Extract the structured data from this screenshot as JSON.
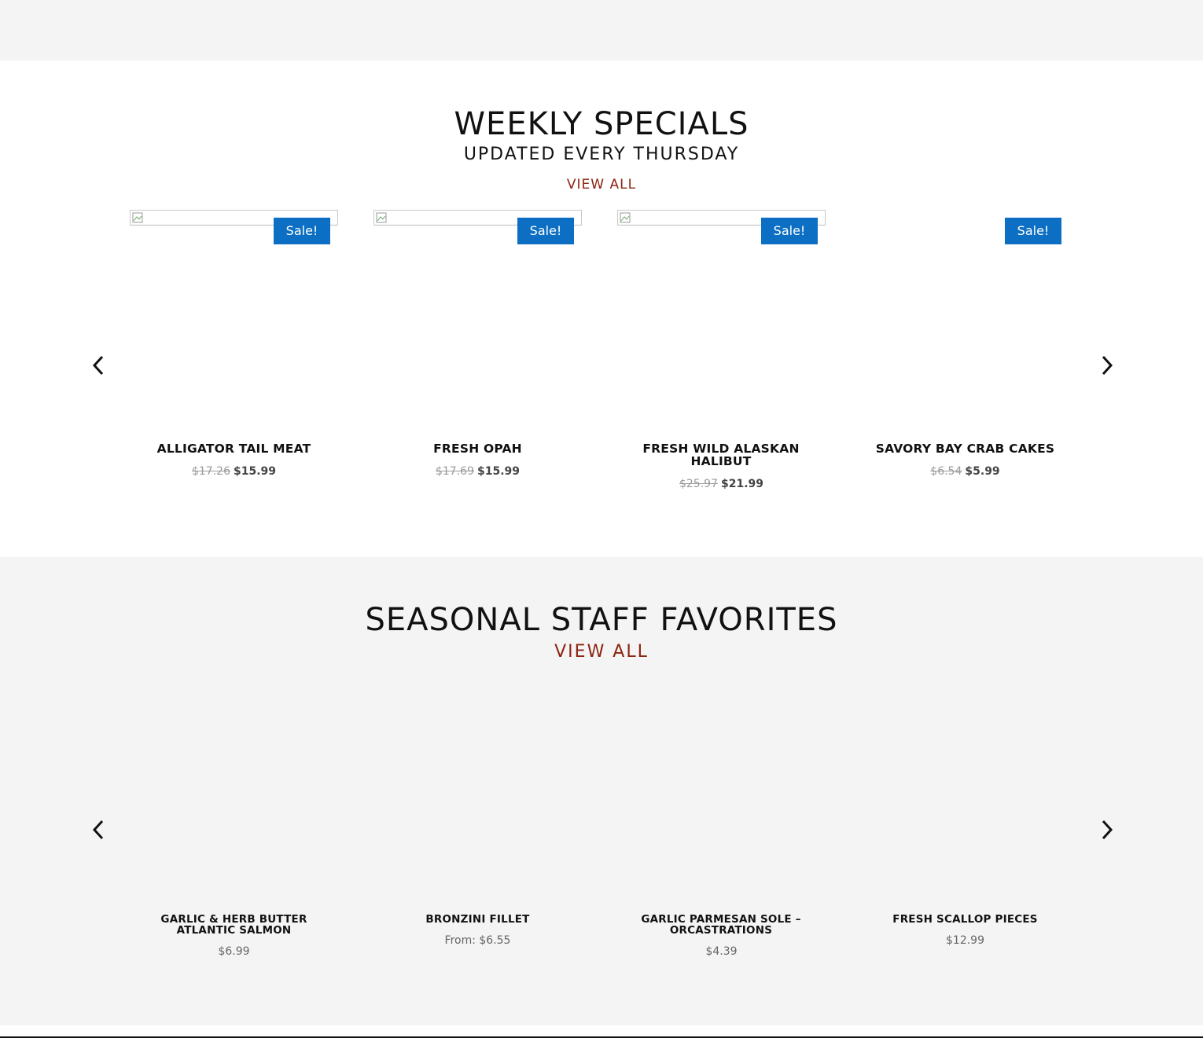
{
  "weekly": {
    "title": "WEEKLY SPECIALS",
    "subtitle": "UPDATED EVERY THURSDAY",
    "view_all": "VIEW ALL",
    "sale_label": "Sale!",
    "products": [
      {
        "name": "ALLIGATOR TAIL MEAT",
        "old_price": "$17.26",
        "price": "$15.99"
      },
      {
        "name": "FRESH OPAH",
        "old_price": "$17.69",
        "price": "$15.99"
      },
      {
        "name": "FRESH WILD ALASKAN HALIBUT",
        "old_price": "$25.97",
        "price": "$21.99"
      },
      {
        "name": "SAVORY BAY CRAB CAKES",
        "old_price": "$6.54",
        "price": "$5.99"
      }
    ]
  },
  "seasonal": {
    "title": "SEASONAL STAFF FAVORITES",
    "view_all": "VIEW ALL",
    "products": [
      {
        "name": "GARLIC & HERB BUTTER ATLANTIC SALMON",
        "price": "$6.99"
      },
      {
        "name": "BRONZINI FILLET",
        "price": "From: $6.55"
      },
      {
        "name": "GARLIC PARMESAN SOLE – ORCASTRATIONS",
        "price": "$4.39"
      },
      {
        "name": "FRESH SCALLOP PIECES",
        "price": "$12.99"
      }
    ]
  },
  "icons": {
    "prev": "chevron-left-icon",
    "next": "chevron-right-icon",
    "broken_image": "broken-image-icon"
  },
  "colors": {
    "sale_badge": "#0c6fc3",
    "view_all": "#8b2410",
    "band_gray": "#f4f4f4"
  }
}
